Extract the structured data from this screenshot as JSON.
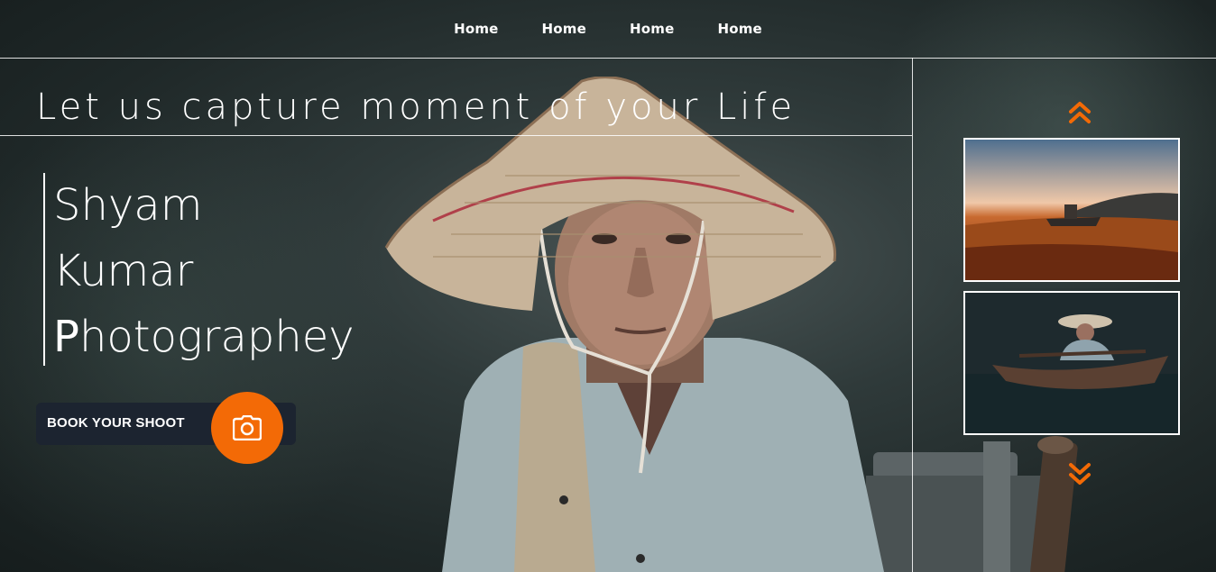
{
  "nav": {
    "items": [
      {
        "label": "Home"
      },
      {
        "label": "Home"
      },
      {
        "label": "Home"
      },
      {
        "label": "Home"
      }
    ]
  },
  "hero": {
    "tagline": "Let us capture moment of your Life",
    "name_lines": [
      "Shyam",
      "Kumar",
      "Photographey"
    ],
    "book_button_label": "BOOK YOUR SHOOT"
  },
  "gallery": {
    "up_icon": "double-chevron-up-icon",
    "down_icon": "double-chevron-down-icon",
    "thumbnails": [
      {
        "subject": "man in boat on golden field at sunset"
      },
      {
        "subject": "man in straw hat rowing boat on dark lake"
      }
    ]
  },
  "colors": {
    "accent": "#f36a06",
    "button_bg": "#1c2430",
    "text": "#ffffff"
  }
}
